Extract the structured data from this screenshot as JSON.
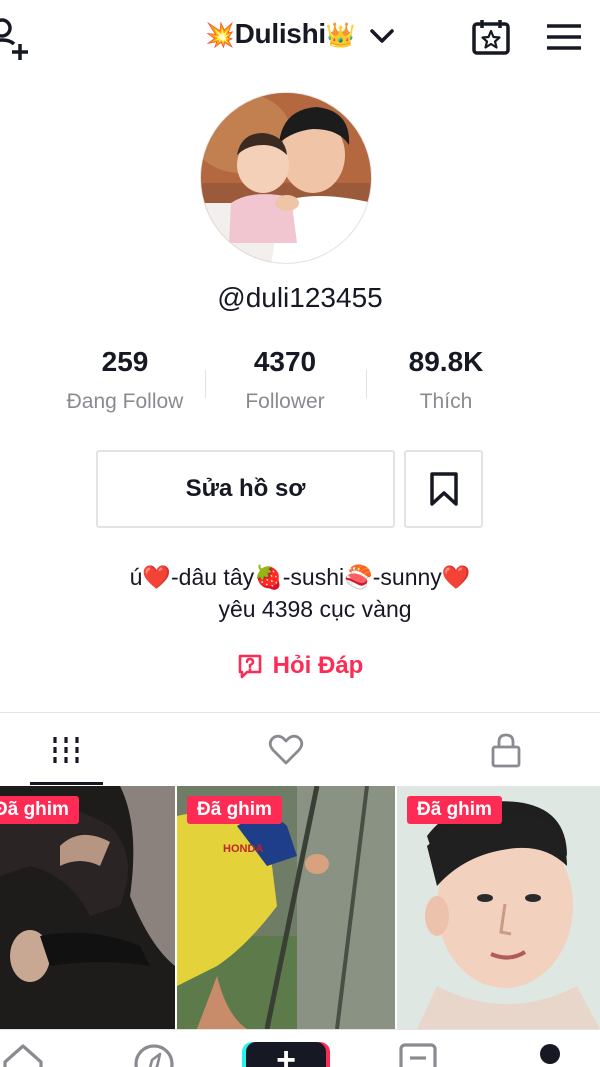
{
  "header": {
    "title_prefix_emoji": "💥",
    "title": "Dulishi",
    "title_suffix_emoji": "👑"
  },
  "profile": {
    "username": "@duli123455",
    "stats": [
      {
        "value": "259",
        "label": "Đang Follow"
      },
      {
        "value": "4370",
        "label": "Follower"
      },
      {
        "value": "89.8K",
        "label": "Thích"
      }
    ],
    "edit_button": "Sửa hồ sơ",
    "bio_line1": "ú❤️-dâu tây🍓-sushi🍣-sunny❤️",
    "bio_line2": "yêu 4398 cục vàng",
    "qa_label": "Hỏi Đáp"
  },
  "videos": [
    {
      "pin_label": "Đã ghim"
    },
    {
      "pin_label": "Đã ghim"
    },
    {
      "pin_label": "Đã ghim"
    }
  ],
  "colors": {
    "accent": "#fe2c55",
    "text": "#161823",
    "muted": "#8a8b91",
    "border": "#e3e3e4"
  }
}
